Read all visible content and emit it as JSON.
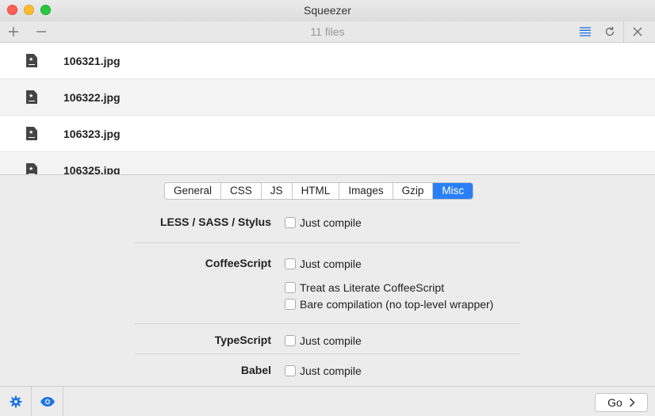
{
  "window": {
    "title": "Squeezer"
  },
  "toolbar": {
    "add_icon": "plus-icon",
    "remove_icon": "minus-icon",
    "files_count": "11 files",
    "list_icon": "list-icon",
    "refresh_icon": "refresh-icon",
    "clear_icon": "close-icon"
  },
  "files": [
    {
      "name": "106321.jpg",
      "icon": "image-file-icon"
    },
    {
      "name": "106322.jpg",
      "icon": "image-file-icon"
    },
    {
      "name": "106323.jpg",
      "icon": "image-file-icon"
    },
    {
      "name": "106325.jpg",
      "icon": "image-file-icon"
    }
  ],
  "tabs": [
    {
      "label": "General",
      "active": false
    },
    {
      "label": "CSS",
      "active": false
    },
    {
      "label": "JS",
      "active": false
    },
    {
      "label": "HTML",
      "active": false
    },
    {
      "label": "Images",
      "active": false
    },
    {
      "label": "Gzip",
      "active": false
    },
    {
      "label": "Misc",
      "active": true
    }
  ],
  "sections": [
    {
      "label": "LESS / SASS / Stylus",
      "options": [
        {
          "label": "Just compile",
          "checked": false
        }
      ]
    },
    {
      "label": "CoffeeScript",
      "options": [
        {
          "label": "Just compile",
          "checked": false
        },
        {
          "label": "Treat as Literate CoffeeScript",
          "checked": false
        },
        {
          "label": "Bare compilation (no top-level wrapper)",
          "checked": false
        }
      ]
    },
    {
      "label": "TypeScript",
      "options": [
        {
          "label": "Just compile",
          "checked": false
        }
      ]
    },
    {
      "label": "Babel",
      "options": [
        {
          "label": "Just compile",
          "checked": false
        }
      ]
    }
  ],
  "bottom": {
    "settings_icon": "gear-icon",
    "preview_icon": "eye-icon",
    "go_label": "Go",
    "go_icon": "chevron-right-icon"
  },
  "colors": {
    "accent": "#2a7ff6",
    "icon_blue": "#1a73e8"
  }
}
